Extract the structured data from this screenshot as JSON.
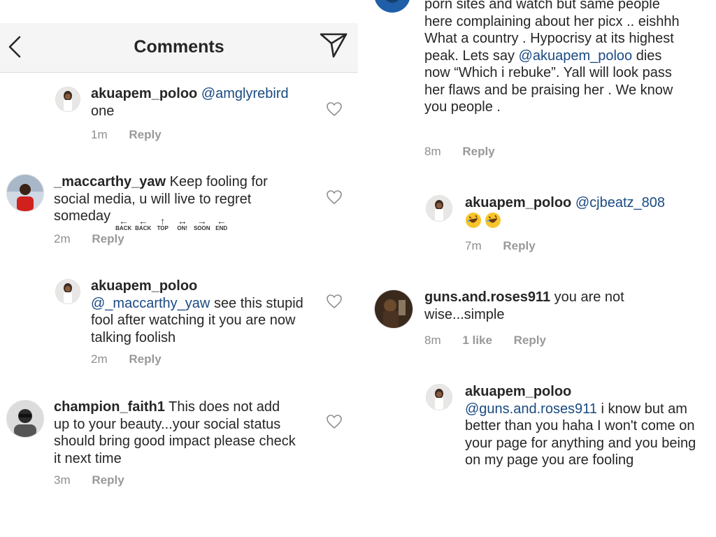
{
  "header": {
    "title": "Comments",
    "back_icon": "chevron-left-icon",
    "send_icon": "paper-plane-icon"
  },
  "left_comments": [
    {
      "username": "akuapem_poloo",
      "mention": "@amglyrebird",
      "text": "one",
      "time": "1m",
      "reply": "Reply"
    },
    {
      "username": "_maccarthy_yaw",
      "text": "Keep fooling for social media, u will live to regret someday",
      "keycaps": [
        {
          "arrow": "←",
          "label": "BACK"
        },
        {
          "arrow": "←",
          "label": "BACK"
        },
        {
          "arrow": "↑",
          "label": "TOP"
        },
        {
          "arrow": "↔",
          "label": "ON!"
        },
        {
          "arrow": "→",
          "label": "SOON"
        },
        {
          "arrow": "←",
          "label": "END"
        }
      ],
      "time": "2m",
      "reply": "Reply"
    },
    {
      "username": "akuapem_poloo",
      "mention": "@_maccarthy_yaw",
      "text": "see this stupid fool after watching it you are now talking foolish",
      "time": "2m",
      "reply": "Reply"
    },
    {
      "username": "champion_faith1",
      "text": "This does not add up to your beauty...your social status should bring good impact please check it next time",
      "time": "3m",
      "reply": "Reply"
    }
  ],
  "right_comments": [
    {
      "text_before": "porn sites and watch but same people here complaining about her picx .. eishhh What a country . Hypocrisy at its highest peak. Lets say",
      "mention": "@akuapem_poloo",
      "text_after": "dies now “Which i rebuke”. Yall will look pass her flaws and be praising her . We know you people .",
      "time": "8m",
      "reply": "Reply"
    },
    {
      "username": "akuapem_poloo",
      "mention": "@cjbeatz_808",
      "emoji": "rolling-on-floor-laughing-emoji",
      "time": "7m",
      "reply": "Reply"
    },
    {
      "username": "guns.and.roses911",
      "text": "you are not wise...simple",
      "time": "8m",
      "likes": "1 like",
      "reply": "Reply"
    },
    {
      "username": "akuapem_poloo",
      "mention": "@guns.and.roses911",
      "text": "i know but am better than you haha I won't come on your page for anything and you being on my page you are fooling"
    }
  ],
  "colors": {
    "mention": "#1a4a82",
    "header_bg": "#f5f5f5",
    "meta": "#8e8e8e"
  }
}
